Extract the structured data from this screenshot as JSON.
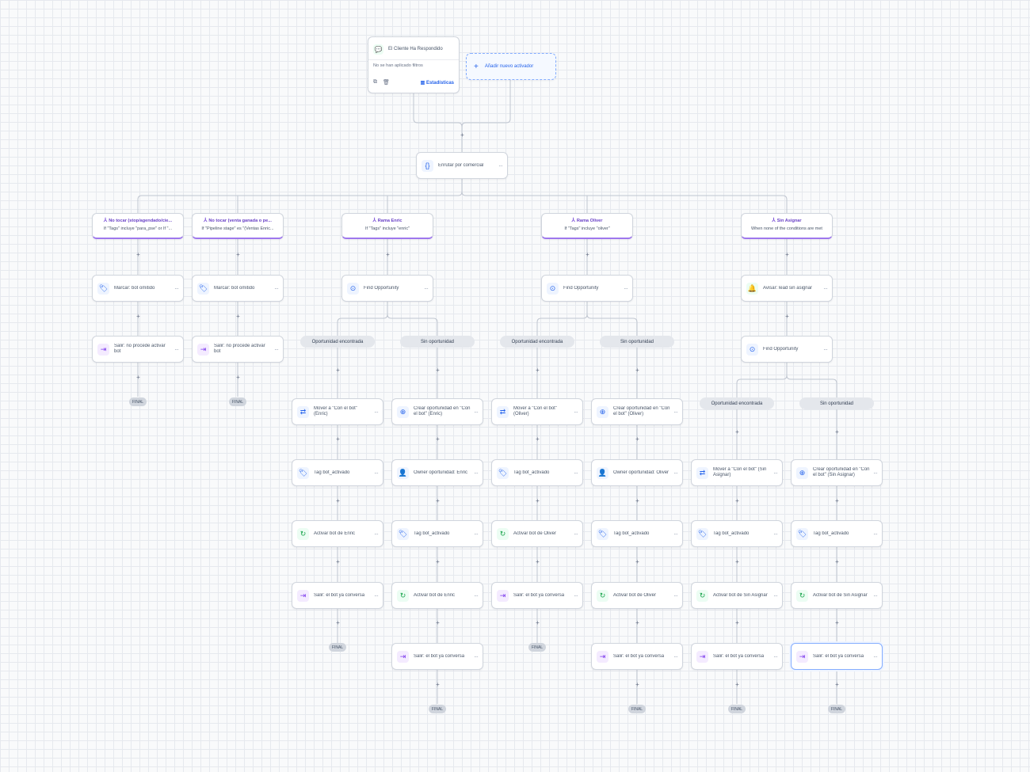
{
  "trigger": {
    "title": "El Cliente Ha Respondido",
    "filter": "No se han aplicado filtros",
    "stats": "Estadísticas",
    "icon": "chat-bubbles-icon"
  },
  "add_trigger": {
    "label": "Añadir nuevo activador"
  },
  "router": {
    "label": "Enrutar por comercial"
  },
  "plus": "+",
  "dots": "···",
  "final": "FINAL",
  "branches": {
    "b1": {
      "title": "No tocar (stop/agendado/cie...",
      "cond": "If \"Tags\" incluye \"para_pse\" or If \"..."
    },
    "b2": {
      "title": "No tocar (venta ganada o pe...",
      "cond": "If \"Pipeline stage\" es \"(Ventas Enric..."
    },
    "b3": {
      "title": "Rama Enric",
      "cond": "If \"Tags\" incluye \"enric\""
    },
    "b4": {
      "title": "Rama Oliver",
      "cond": "If \"Tags\" incluye \"oliver\""
    },
    "b5": {
      "title": "Sin Asignar",
      "cond": "When none of the conditions are met"
    }
  },
  "pills": {
    "found": "Oportunidad encontrada",
    "none": "Sin oportunidad"
  },
  "nodes": {
    "marcar1": "Marcar: bot omitido",
    "marcar2": "Marcar: bot omitido",
    "salir1": "Salir: no procede activar bot",
    "salir2": "Salir: no procede activar bot",
    "find_enric": "Find Opportunity",
    "find_oliver": "Find Opportunity",
    "avisar": "Avisar: lead sin asignar",
    "find_sin": "Find Opportunity",
    "e_mover": "Mover a \"Con el bot\" (Enric)",
    "e_tag": "Tag bot_activado",
    "e_activar": "Activar bot de Enric",
    "e_salir": "Salir: el bot ya conversa",
    "e2_crear": "Crear oportunidad en \"Con el bot\" (Enric)",
    "e2_owner": "Owner oportunidad: Enric",
    "e2_tag": "Tag bot_activado",
    "e2_activar": "Activar bot de Enric",
    "e2_salir": "Salir: el bot ya conversa",
    "o_mover": "Mover a \"Con el bot\" (Oliver)",
    "o_tag": "Tag bot_activado",
    "o_activar": "Activar bot de Oliver",
    "o_salir": "Salir: el bot ya conversa",
    "o2_crear": "Crear oportunidad en \"Con el bot\" (Oliver)",
    "o2_owner": "Owner oportunidad: Oliver",
    "o2_tag": "Tag bot_activado",
    "o2_activar": "Activar bot de Oliver",
    "o2_salir": "Salir: el bot ya conversa",
    "s_mover": "Mover a \"Con el bot\" (Sin Asignar)",
    "s_tag": "Tag bot_activado",
    "s_activar": "Activar bot de Sin Asignar",
    "s_salir": "Salir: el bot ya conversa",
    "s2_crear": "Crear oportunidad en \"Con el bot\" (Sin Asignar)",
    "s2_tag": "Tag bot_activado",
    "s2_activar": "Activar bot de Sin Asignar",
    "s2_salir": "Salir: el bot ya conversa"
  },
  "colors": {
    "branch_accent": "#9e77ed",
    "link": "#2563eb",
    "selected_border": "#84adff"
  }
}
